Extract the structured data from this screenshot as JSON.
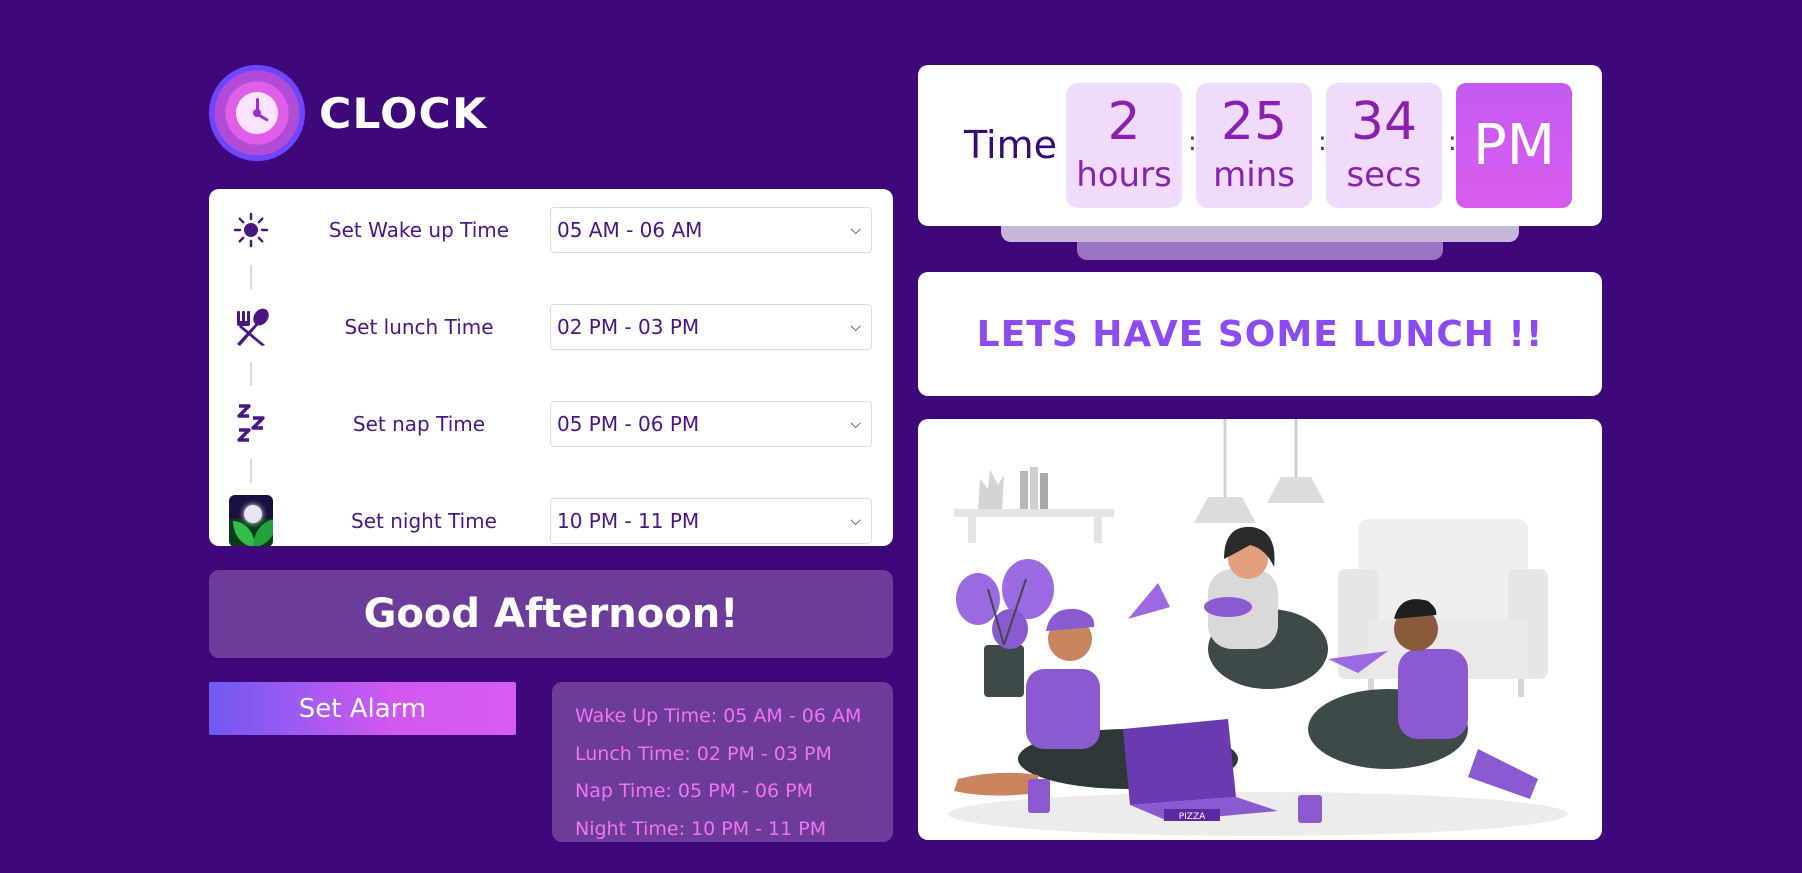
{
  "logo": {
    "text": "CLOCK",
    "icon": "clock-icon"
  },
  "schedule": [
    {
      "icon": "sun-icon",
      "label": "Set Wake up Time",
      "value": "05 AM - 06 AM"
    },
    {
      "icon": "fork-spoon-icon",
      "label": "Set lunch Time",
      "value": "02 PM - 03 PM"
    },
    {
      "icon": "zzz-icon",
      "label": "Set nap Time",
      "value": "05 PM - 06 PM"
    },
    {
      "icon": "moon-night-icon",
      "label": "Set night Time",
      "value": "10 PM - 11 PM"
    }
  ],
  "greeting": "Good Afternoon!",
  "alarm_button": "Set Alarm",
  "summary": [
    "Wake Up Time: 05 AM - 06 AM",
    "Lunch Time: 02 PM - 03 PM",
    "Nap Time: 05 PM - 06 PM",
    "Night Time: 10 PM - 11 PM"
  ],
  "clock": {
    "label": "Time",
    "hours": "2",
    "hours_unit": "hours",
    "mins": "25",
    "mins_unit": "mins",
    "secs": "34",
    "secs_unit": "secs",
    "period": "PM",
    "separator": ":"
  },
  "message": "LETS HAVE SOME LUNCH !!",
  "illustration": {
    "box_label": "PIZZA"
  },
  "colors": {
    "background": "#3e087a",
    "accent": "#d159f0",
    "panel": "#6b3c9a",
    "summary_text": "#f273f2",
    "message_text": "#8a4cf0"
  }
}
